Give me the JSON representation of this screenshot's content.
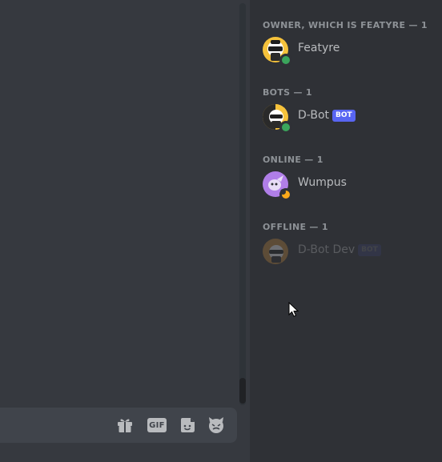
{
  "members": {
    "sections": [
      {
        "header": "Owner, which is Featyre — 1",
        "members": [
          {
            "name": "Featyre",
            "status": "online",
            "bot": false
          }
        ]
      },
      {
        "header": "Bots — 1",
        "members": [
          {
            "name": "D-Bot",
            "status": "online",
            "bot": true,
            "bot_label": "BOT"
          }
        ]
      },
      {
        "header": "Online — 1",
        "members": [
          {
            "name": "Wumpus",
            "status": "idle",
            "bot": false
          }
        ]
      },
      {
        "header": "Offline — 1",
        "members": [
          {
            "name": "D-Bot Dev",
            "status": "offline",
            "bot": true,
            "bot_label": "BOT"
          }
        ]
      }
    ]
  },
  "composer": {
    "gift_icon": "gift-icon",
    "gif_label": "GIF",
    "sticker_icon": "sticker-icon",
    "emoji_icon": "emoji-icon"
  },
  "colors": {
    "chat_bg": "#36393f",
    "members_bg": "#2f3136",
    "composer_bg": "#40444b",
    "online": "#3ba55c",
    "idle": "#faa81a",
    "bot_tag": "#5865f2",
    "header_text": "#8e9297",
    "member_text": "#b9bbbe"
  }
}
